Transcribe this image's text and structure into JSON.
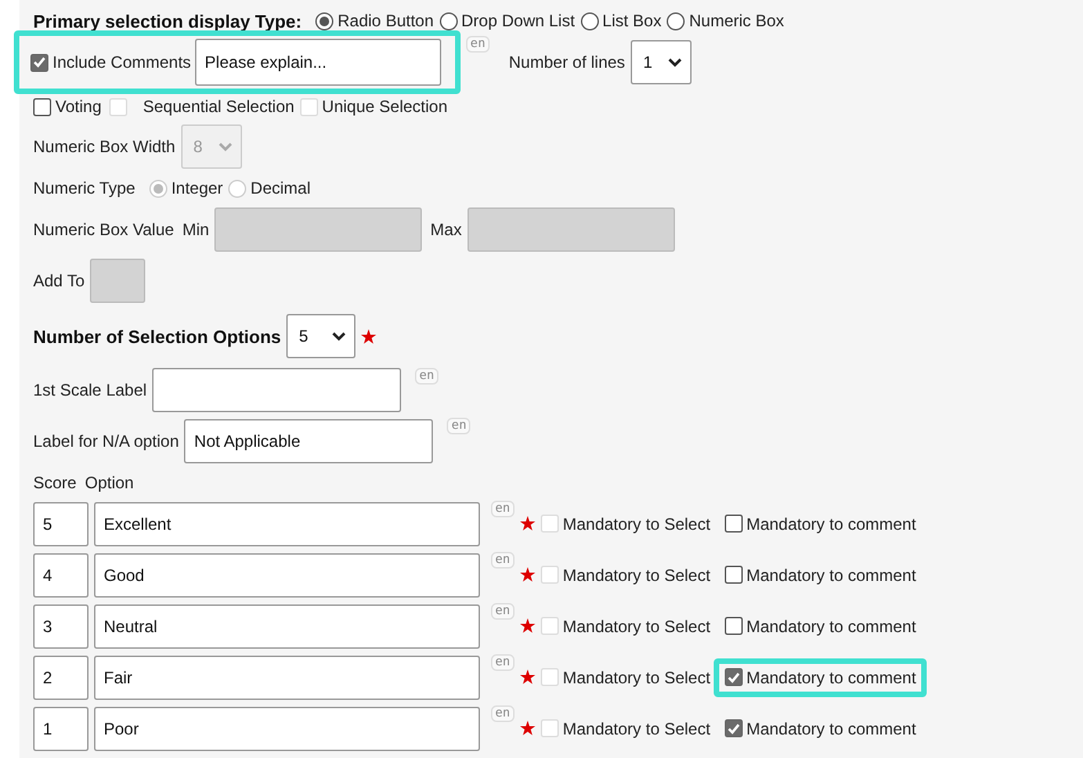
{
  "display_type": {
    "label": "Primary selection display Type:",
    "options": [
      {
        "label": "Radio Button",
        "selected": true
      },
      {
        "label": "Drop Down List",
        "selected": false
      },
      {
        "label": "List Box",
        "selected": false
      },
      {
        "label": "Numeric Box",
        "selected": false
      }
    ]
  },
  "include_comments": {
    "label": "Include Comments",
    "checked": true,
    "highlighted": true,
    "value": "Please explain...",
    "lang": "en"
  },
  "number_of_lines": {
    "label": "Number of lines",
    "value": "1"
  },
  "flags": [
    {
      "label": "Voting",
      "checked": false,
      "disabled": false
    },
    {
      "label": "Sequential Selection",
      "checked": false,
      "disabled": true
    },
    {
      "label": "Unique Selection",
      "checked": false,
      "disabled": true
    }
  ],
  "numeric_box_width": {
    "label": "Numeric Box Width",
    "value": "8",
    "disabled": true
  },
  "numeric_type": {
    "label": "Numeric Type",
    "options": [
      {
        "label": "Integer",
        "selected": true
      },
      {
        "label": "Decimal",
        "selected": false
      }
    ]
  },
  "numeric_box_value": {
    "label": "Numeric Box Value",
    "min_label": "Min",
    "max_label": "Max"
  },
  "add_to": {
    "label": "Add To"
  },
  "selection_options": {
    "label": "Number of Selection Options",
    "value": "5"
  },
  "scale_label": {
    "label": "1st Scale Label",
    "lang": "en"
  },
  "na_label": {
    "label": "Label for N/A option",
    "value": "Not Applicable",
    "lang": "en"
  },
  "columns": [
    "Score",
    "Option"
  ],
  "rows": [
    {
      "score": "5",
      "option": "Excellent",
      "lang": "en",
      "select_label": "Mandatory to Select",
      "mandatory_select": false,
      "comment_label": "Mandatory to comment",
      "mandatory_comment": false,
      "highlighted": false
    },
    {
      "score": "4",
      "option": "Good",
      "lang": "en",
      "select_label": "Mandatory to Select",
      "mandatory_select": false,
      "comment_label": "Mandatory to comment",
      "mandatory_comment": false,
      "highlighted": false
    },
    {
      "score": "3",
      "option": "Neutral",
      "lang": "en",
      "select_label": "Mandatory to Select",
      "mandatory_select": false,
      "comment_label": "Mandatory to comment",
      "mandatory_comment": false,
      "highlighted": false
    },
    {
      "score": "2",
      "option": "Fair",
      "lang": "en",
      "select_label": "Mandatory to Select",
      "mandatory_select": false,
      "comment_label": "Mandatory to comment",
      "mandatory_comment": true,
      "highlighted": true
    },
    {
      "score": "1",
      "option": "Poor",
      "lang": "en",
      "select_label": "Mandatory to Select",
      "mandatory_select": false,
      "comment_label": "Mandatory to comment",
      "mandatory_comment": true,
      "highlighted": false
    }
  ]
}
